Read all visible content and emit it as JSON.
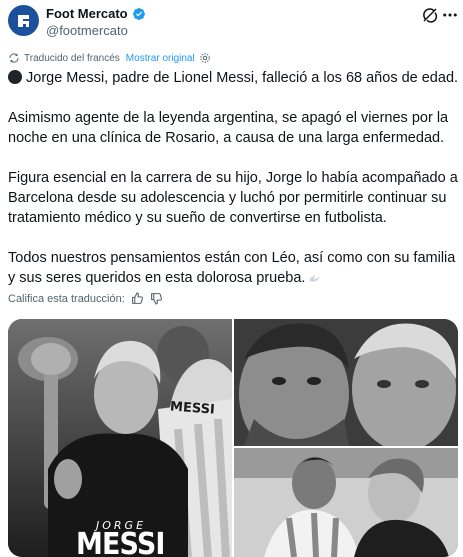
{
  "account": {
    "display_name": "Foot Mercato",
    "handle": "@footmercato",
    "avatar_icon": "foot-mercato-logo",
    "verified_icon": "verified-badge-icon",
    "brand_color": "#1c4f9c"
  },
  "translation": {
    "translated_from": "Traducido del francés",
    "show_original": "Mostrar original"
  },
  "tweet": {
    "p1": "Jorge Messi, padre de Lionel Messi, falleció a los 68 años de edad.",
    "p2": "Asimismo agente de la leyenda argentina, se apagó el viernes por la noche en una clínica de Rosario, a causa de una larga enfermedad.",
    "p3": "Figura esencial en la carrera de su hijo, Jorge lo había acompañado a Barcelona desde su adolescencia y luchó por permitirle continuar su tratamiento médico y su sueño de convertirse en futbolista.",
    "p4": "Todos nuestros pensamientos están con Léo, así como con su familia y sus seres queridos en esta dolorosa prueba."
  },
  "rate": {
    "label": "Califica esta traducción:"
  },
  "media": {
    "main_first_name": "JORGE",
    "main_last_name": "MESSI",
    "shirt_text": "MESSI"
  },
  "colors": {
    "accent": "#1d9bf0",
    "text": "#0f1419",
    "secondary": "#536471"
  }
}
